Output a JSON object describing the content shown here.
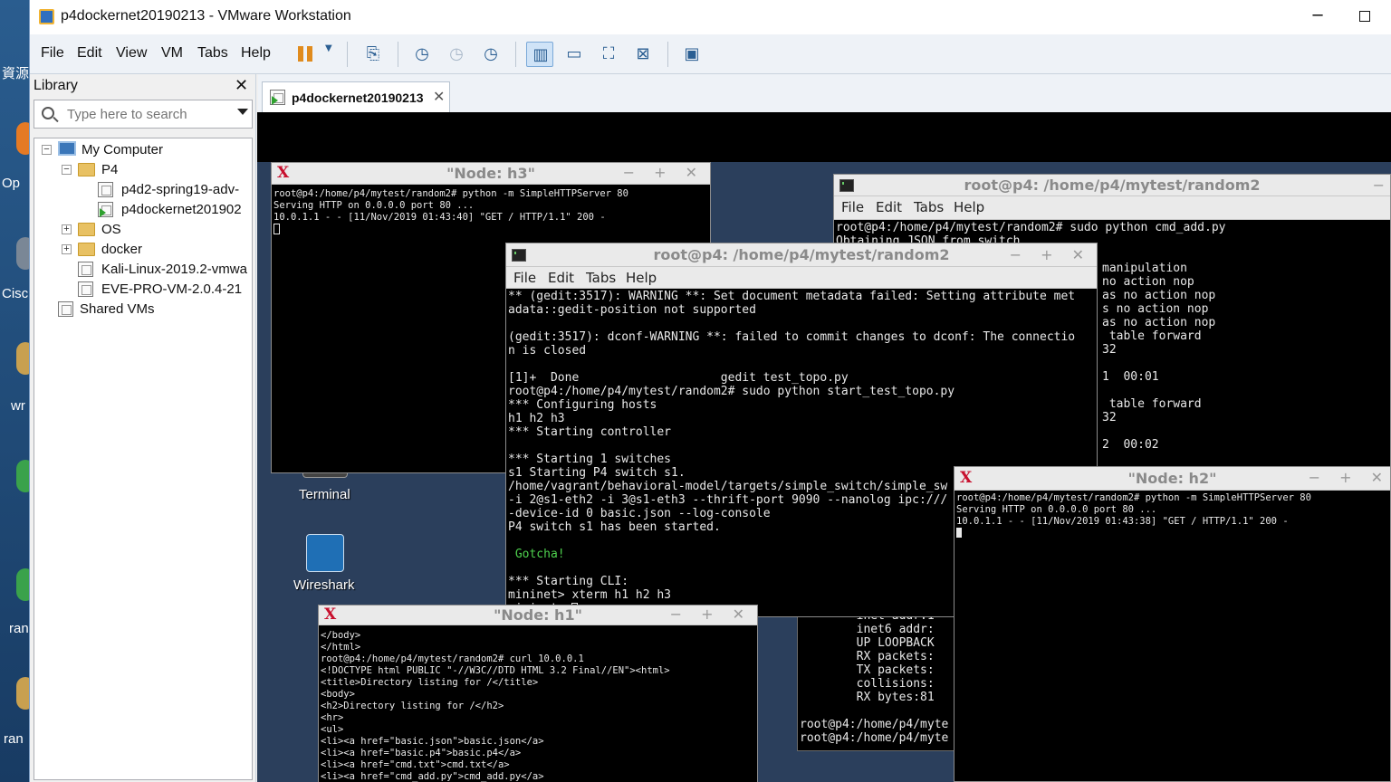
{
  "host": {
    "labels": [
      "資源",
      "Op",
      "Cisc",
      "wr",
      "ran",
      "ran"
    ]
  },
  "window": {
    "title": "p4dockernet20190213 - VMware Workstation",
    "minimize_glyph": "─"
  },
  "menu": [
    "File",
    "Edit",
    "View",
    "VM",
    "Tabs",
    "Help"
  ],
  "toolbar_icons": [
    "pause-icon",
    "send-ctrl-alt-del-icon",
    "snapshot-take-icon",
    "snapshot-revert-icon",
    "snapshot-manager-icon",
    "show-library-icon",
    "thumbnail-bar-icon",
    "full-screen-icon",
    "unity-icon",
    "console-view-icon"
  ],
  "library": {
    "title": "Library",
    "close_glyph": "✕",
    "search_placeholder": "Type here to search",
    "tree": [
      {
        "label": "My Computer",
        "expander": "−"
      },
      {
        "label": "P4",
        "expander": "−"
      },
      {
        "label": "p4d2-spring19-adv-"
      },
      {
        "label": "p4dockernet201902"
      },
      {
        "label": "OS",
        "expander": "+"
      },
      {
        "label": "docker",
        "expander": "+"
      },
      {
        "label": "Kali-Linux-2019.2-vmwa"
      },
      {
        "label": "EVE-PRO-VM-2.0.4-21"
      },
      {
        "label": "Shared VMs"
      }
    ]
  },
  "vm_tab": {
    "label": "p4dockernet20190213",
    "close_glyph": "✕"
  },
  "desktop_icons": {
    "terminal": "Terminal",
    "wireshark": "Wireshark"
  },
  "term_controls": "− + ✕",
  "xterm_logo": "X",
  "gnome_menu": [
    "File",
    "Edit",
    "Tabs",
    "Help"
  ],
  "h3": {
    "title": "\"Node: h3\"",
    "lines": [
      "root@p4:/home/p4/mytest/random2# python -m SimpleHTTPServer 80",
      "Serving HTTP on 0.0.0.0 port 80 ...",
      "10.0.1.1 - - [11/Nov/2019 01:43:40] \"GET / HTTP/1.1\" 200 -"
    ]
  },
  "back_term": {
    "title": "root@p4: /home/p4/mytest/random2",
    "lines": [
      "root@p4:/home/p4/mytest/random2# sudo python cmd_add.py",
      "Obtaining JSON from switch..."
    ],
    "right_lines": [
      "manipulation",
      "no action nop",
      "as no action nop",
      "s no action nop",
      "as no action nop",
      " table forward",
      "32",
      "",
      "1  00:01",
      "",
      " table forward",
      "32",
      "",
      "2  00:02"
    ]
  },
  "main_term": {
    "title": "root@p4: /home/p4/mytest/random2",
    "lines": [
      "** (gedit:3517): WARNING **: Set document metadata failed: Setting attribute met",
      "adata::gedit-position not supported",
      "",
      "(gedit:3517): dconf-WARNING **: failed to commit changes to dconf: The connectio",
      "n is closed",
      "",
      "[1]+  Done                    gedit test_topo.py",
      "root@p4:/home/p4/mytest/random2# sudo python start_test_topo.py",
      "*** Configuring hosts",
      "h1 h2 h3",
      "*** Starting controller",
      "",
      "*** Starting 1 switches",
      "s1 Starting P4 switch s1.",
      "/home/vagrant/behavioral-model/targets/simple_switch/simple_sw",
      "-i 2@s1-eth2 -i 3@s1-eth3 --thrift-port 9090 --nanolog ipc:///",
      "-device-id 0 basic.json --log-console",
      "P4 switch s1 has been started.",
      "",
      " Gotcha!",
      "",
      "*** Starting CLI:",
      "mininet> xterm h1 h2 h3",
      "mininet> "
    ]
  },
  "mid_term": {
    "lines": [
      "        inet addr:1",
      "        inet6 addr:",
      "        UP LOOPBACK",
      "        RX packets:",
      "        TX packets:",
      "        collisions:",
      "        RX bytes:81",
      "",
      "root@p4:/home/p4/myte",
      "root@p4:/home/p4/myte"
    ]
  },
  "h2": {
    "title": "\"Node: h2\"",
    "lines": [
      "root@p4:/home/p4/mytest/random2# python -m SimpleHTTPServer 80",
      "Serving HTTP on 0.0.0.0 port 80 ...",
      "10.0.1.1 - - [11/Nov/2019 01:43:38] \"GET / HTTP/1.1\" 200 -"
    ]
  },
  "h1": {
    "title": "\"Node: h1\"",
    "lines": [
      "</body>",
      "</html>",
      "root@p4:/home/p4/mytest/random2# curl 10.0.0.1",
      "<!DOCTYPE html PUBLIC \"-//W3C//DTD HTML 3.2 Final//EN\"><html>",
      "<title>Directory listing for /</title>",
      "<body>",
      "<h2>Directory listing for /</h2>",
      "<hr>",
      "<ul>",
      "<li><a href=\"basic.json\">basic.json</a>",
      "<li><a href=\"basic.p4\">basic.p4</a>",
      "<li><a href=\"cmd.txt\">cmd.txt</a>",
      "<li><a href=\"cmd_add.py\">cmd_add.py</a>"
    ]
  }
}
